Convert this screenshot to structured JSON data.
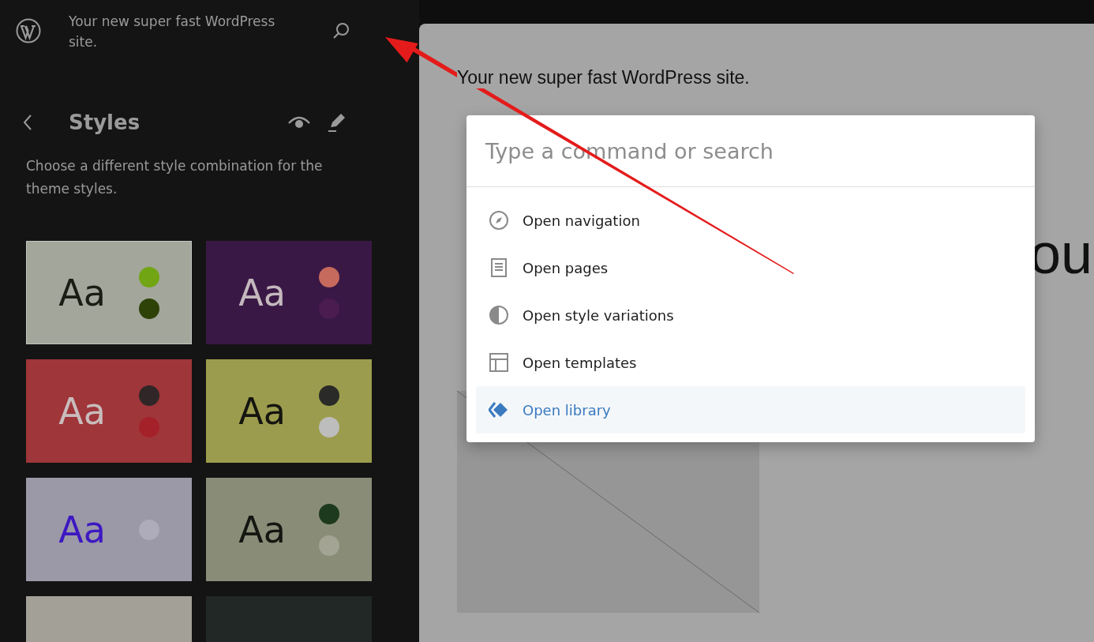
{
  "sidebar": {
    "site_title": "Your new super fast WordPress site.",
    "panel_title": "Styles",
    "description": "Choose a different style combination for the theme styles.",
    "variations": [
      {
        "sample": {
          "text": "Aa",
          "color": "#1a1d14"
        },
        "selected": true,
        "color": "#a3a69a",
        "dots": [
          {
            "color": "#71a513"
          },
          {
            "color": "#2e4207"
          }
        ]
      },
      {
        "sample": {
          "text": "Aa",
          "color": "#c4b8bd"
        },
        "selected": false,
        "color": "#3a1845",
        "dots": [
          {
            "color": "#c56a5c"
          },
          {
            "color": "#4a1c50"
          }
        ]
      },
      {
        "sample": {
          "text": "Aa",
          "color": "#c9bcbc"
        },
        "selected": false,
        "color": "#9f363a",
        "dots": [
          {
            "color": "#302627"
          },
          {
            "color": "#a5212a"
          }
        ]
      },
      {
        "sample": {
          "text": "Aa",
          "color": "#151510"
        },
        "selected": false,
        "color": "#9c9c4e",
        "dots": [
          {
            "color": "#2a2a28"
          },
          {
            "color": "#bdbdbd"
          }
        ]
      },
      {
        "sample": {
          "text": "Aa",
          "color": "#3d18c2"
        },
        "selected": false,
        "color": "#9b98a8",
        "dots": [
          {
            "color": "#aeabbb"
          }
        ]
      },
      {
        "sample": {
          "text": "Aa",
          "color": "#141611"
        },
        "selected": false,
        "color": "#898d78",
        "dots": [
          {
            "color": "#1d3a1f"
          },
          {
            "color": "#a3a493"
          }
        ]
      },
      {
        "selected": false,
        "color": "#a3a097"
      },
      {
        "selected": false,
        "color": "#222826"
      }
    ]
  },
  "canvas": {
    "site_title": "Your new super fast WordPress site.",
    "heading_fragment": "ou"
  },
  "command_palette": {
    "placeholder": "Type a command or search",
    "items": [
      {
        "kind": "compass",
        "label": "Open navigation",
        "selected": false
      },
      {
        "kind": "page",
        "label": "Open pages",
        "selected": false
      },
      {
        "kind": "contrast",
        "label": "Open style variations",
        "selected": false
      },
      {
        "kind": "layout",
        "label": "Open templates",
        "selected": false
      },
      {
        "kind": "diamond",
        "label": "Open library",
        "selected": true
      }
    ]
  }
}
